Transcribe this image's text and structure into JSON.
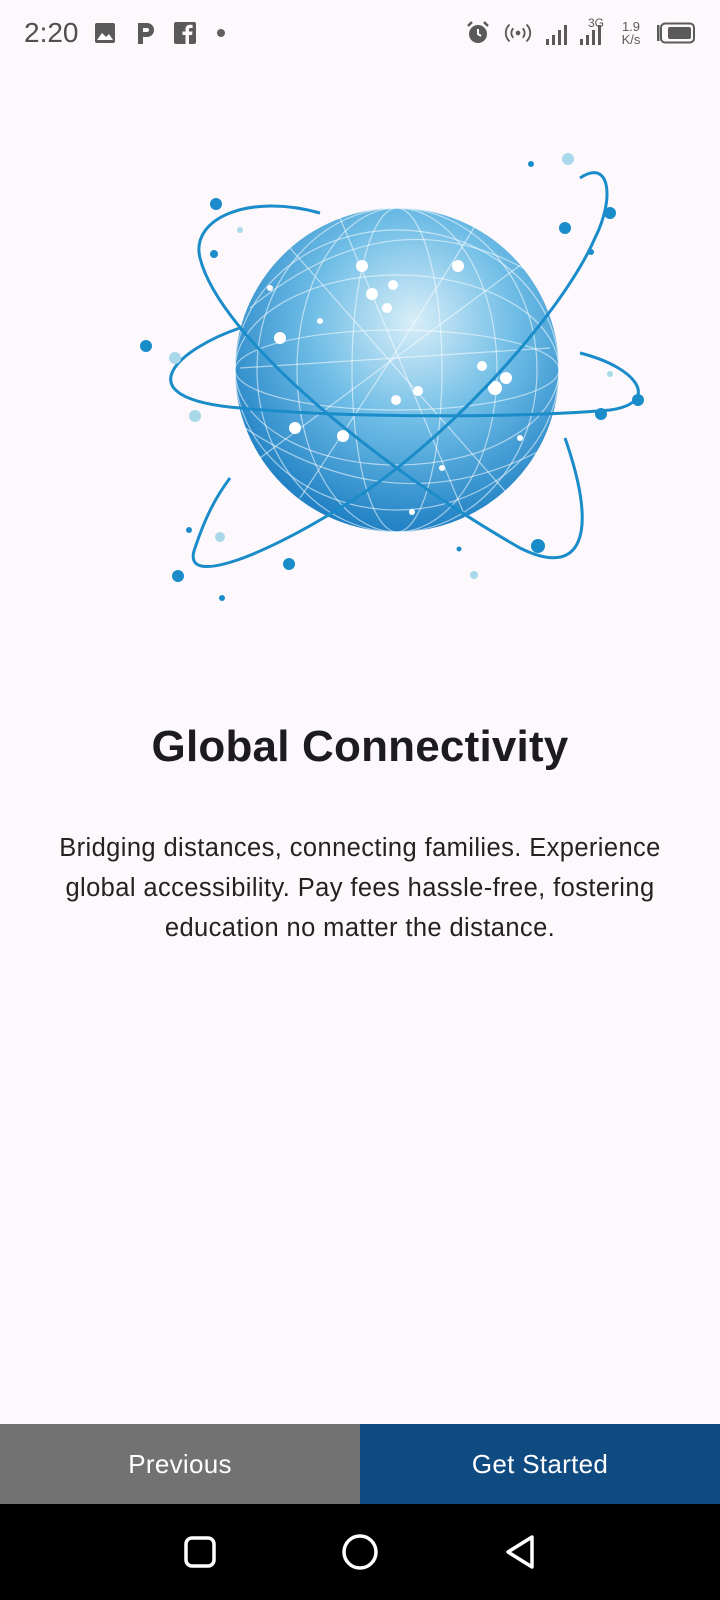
{
  "status_bar": {
    "time": "2:20",
    "network_type": "3G",
    "speed_value": "1.9",
    "speed_unit": "K/s",
    "icons": [
      "image-icon",
      "p-app-icon",
      "facebook-icon",
      "dot-icon",
      "alarm-icon",
      "hotspot-icon",
      "signal-icon",
      "battery-icon"
    ]
  },
  "onboarding": {
    "title": "Global Connectivity",
    "description": "Bridging distances, connecting families. Experience global accessibility. Pay fees hassle-free, fostering education no matter the distance."
  },
  "buttons": {
    "previous_label": "Previous",
    "get_started_label": "Get Started"
  },
  "nav_bar": {
    "icons": [
      "recents-icon",
      "home-icon",
      "back-icon"
    ]
  },
  "colors": {
    "background": "#fdf8fc",
    "previous_button": "#727272",
    "primary_button": "#0f4a81",
    "globe_blue": "#1a8cc9"
  }
}
